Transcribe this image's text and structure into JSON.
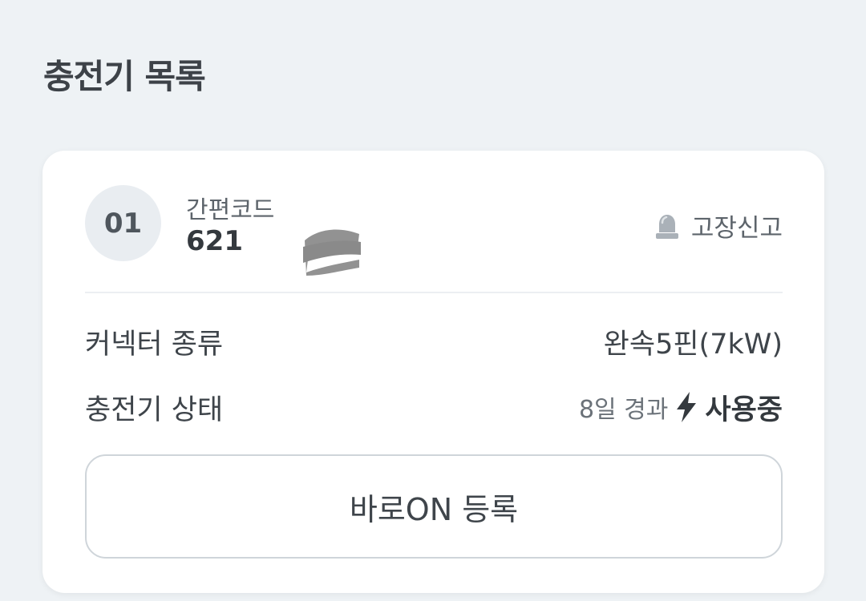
{
  "page": {
    "section_title": "충전기 목록"
  },
  "charger": {
    "number": "01",
    "code_label": "간편코드",
    "code_value": "621",
    "report_label": "고장신고",
    "report_icon": "siren-icon",
    "rows": [
      {
        "label": "커넥터 종류",
        "value": "완속5핀(7kW)"
      },
      {
        "label": "충전기 상태",
        "elapsed": "8일 경과",
        "status": "사용중",
        "status_icon": "lightning-icon"
      }
    ],
    "cta_label": "바로ON 등록"
  },
  "colors": {
    "background": "#eef2f5",
    "card": "#ffffff",
    "badge": "#e9edf1",
    "text_primary": "#34393e",
    "text_secondary": "#6b7279"
  }
}
